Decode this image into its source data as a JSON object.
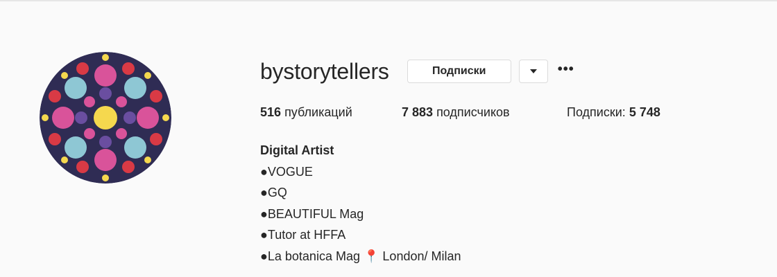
{
  "profile": {
    "username": "bystorytellers",
    "follow_button_label": "Подписки",
    "more_glyph": "•••",
    "dropdown_icon": "caret-down-icon"
  },
  "stats": {
    "posts_count": "516",
    "posts_label": "публикаций",
    "followers_count": "7 883",
    "followers_label": "подписчиков",
    "following_label": "Подписки:",
    "following_count": "5 748"
  },
  "bio": {
    "full_name": "Digital Artist",
    "lines": [
      "●VOGUE",
      "●GQ",
      "●BEAUTIFUL Mag",
      "●Tutor at HFFA"
    ],
    "last_line_prefix": "●La botanica Mag",
    "last_line_pin": "📍",
    "last_line_suffix": "London/ Milan"
  },
  "colors": {
    "background": "#fafafa",
    "avatar_bg": "#2f2c54",
    "pink": "#d9539a",
    "light_blue": "#8ec7d4",
    "yellow": "#f5d84e",
    "red": "#d93a45",
    "purple": "#6a4ea0"
  }
}
